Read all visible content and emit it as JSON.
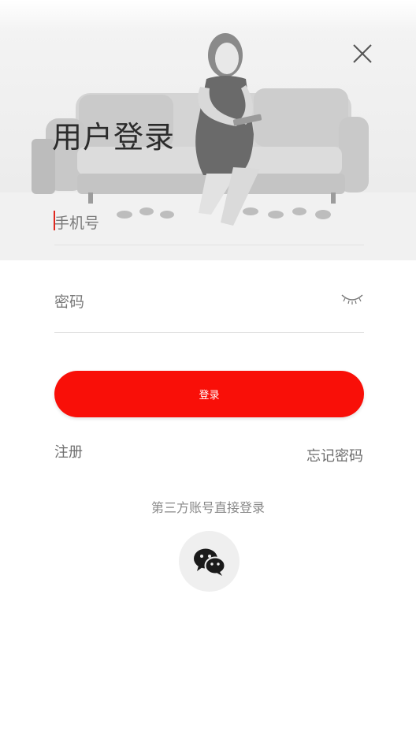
{
  "header": {
    "title": "用户登录",
    "close_icon": "close-icon"
  },
  "form": {
    "phone_placeholder": "手机号",
    "password_placeholder": "密码",
    "password_toggle_icon": "eye-closed-icon",
    "login_label": "登录"
  },
  "links": {
    "register": "注册",
    "forgot_password": "忘记密码"
  },
  "third_party": {
    "title": "第三方账号直接登录",
    "wechat_icon": "wechat-icon"
  },
  "colors": {
    "accent": "#f90f08",
    "title_text": "#2b2b2b",
    "secondary_text": "#6e6e6e"
  }
}
